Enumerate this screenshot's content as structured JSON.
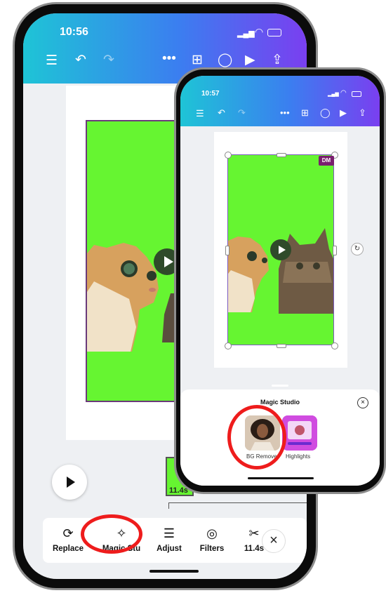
{
  "back_phone": {
    "status": {
      "time": "10:56"
    },
    "topbar_icons": [
      "menu-icon",
      "undo-icon",
      "redo-icon",
      "more-icon",
      "add-page-icon",
      "comment-icon",
      "play-icon",
      "share-icon"
    ],
    "timeline": {
      "duration_label": "11.4s"
    },
    "toolbar": {
      "items": [
        {
          "label": "Replace",
          "icon": "replace-icon"
        },
        {
          "label": "Magic Stu",
          "icon": "magic-sparkle-icon"
        },
        {
          "label": "Adjust",
          "icon": "adjust-sliders-icon"
        },
        {
          "label": "Filters",
          "icon": "filters-icon"
        },
        {
          "label": "11.4s",
          "icon": "scissors-icon"
        }
      ],
      "close_glyph": "×"
    }
  },
  "front_phone": {
    "status": {
      "time": "10:57"
    },
    "topbar_icons": [
      "menu-icon",
      "undo-icon",
      "redo-icon",
      "more-icon",
      "add-page-icon",
      "comment-icon",
      "play-icon",
      "share-icon"
    ],
    "badge": "DM",
    "panel": {
      "title": "Magic Studio",
      "close_glyph": "×",
      "items": [
        {
          "label": "BG Remover"
        },
        {
          "label": "Highlights"
        }
      ]
    }
  },
  "colors": {
    "topbar_gradient_start": "#1ec4d6",
    "topbar_gradient_end": "#7a3ff0",
    "green_screen": "#66f531",
    "annotation_red": "#ee1c1c",
    "badge_purple": "#7a1f6e"
  }
}
